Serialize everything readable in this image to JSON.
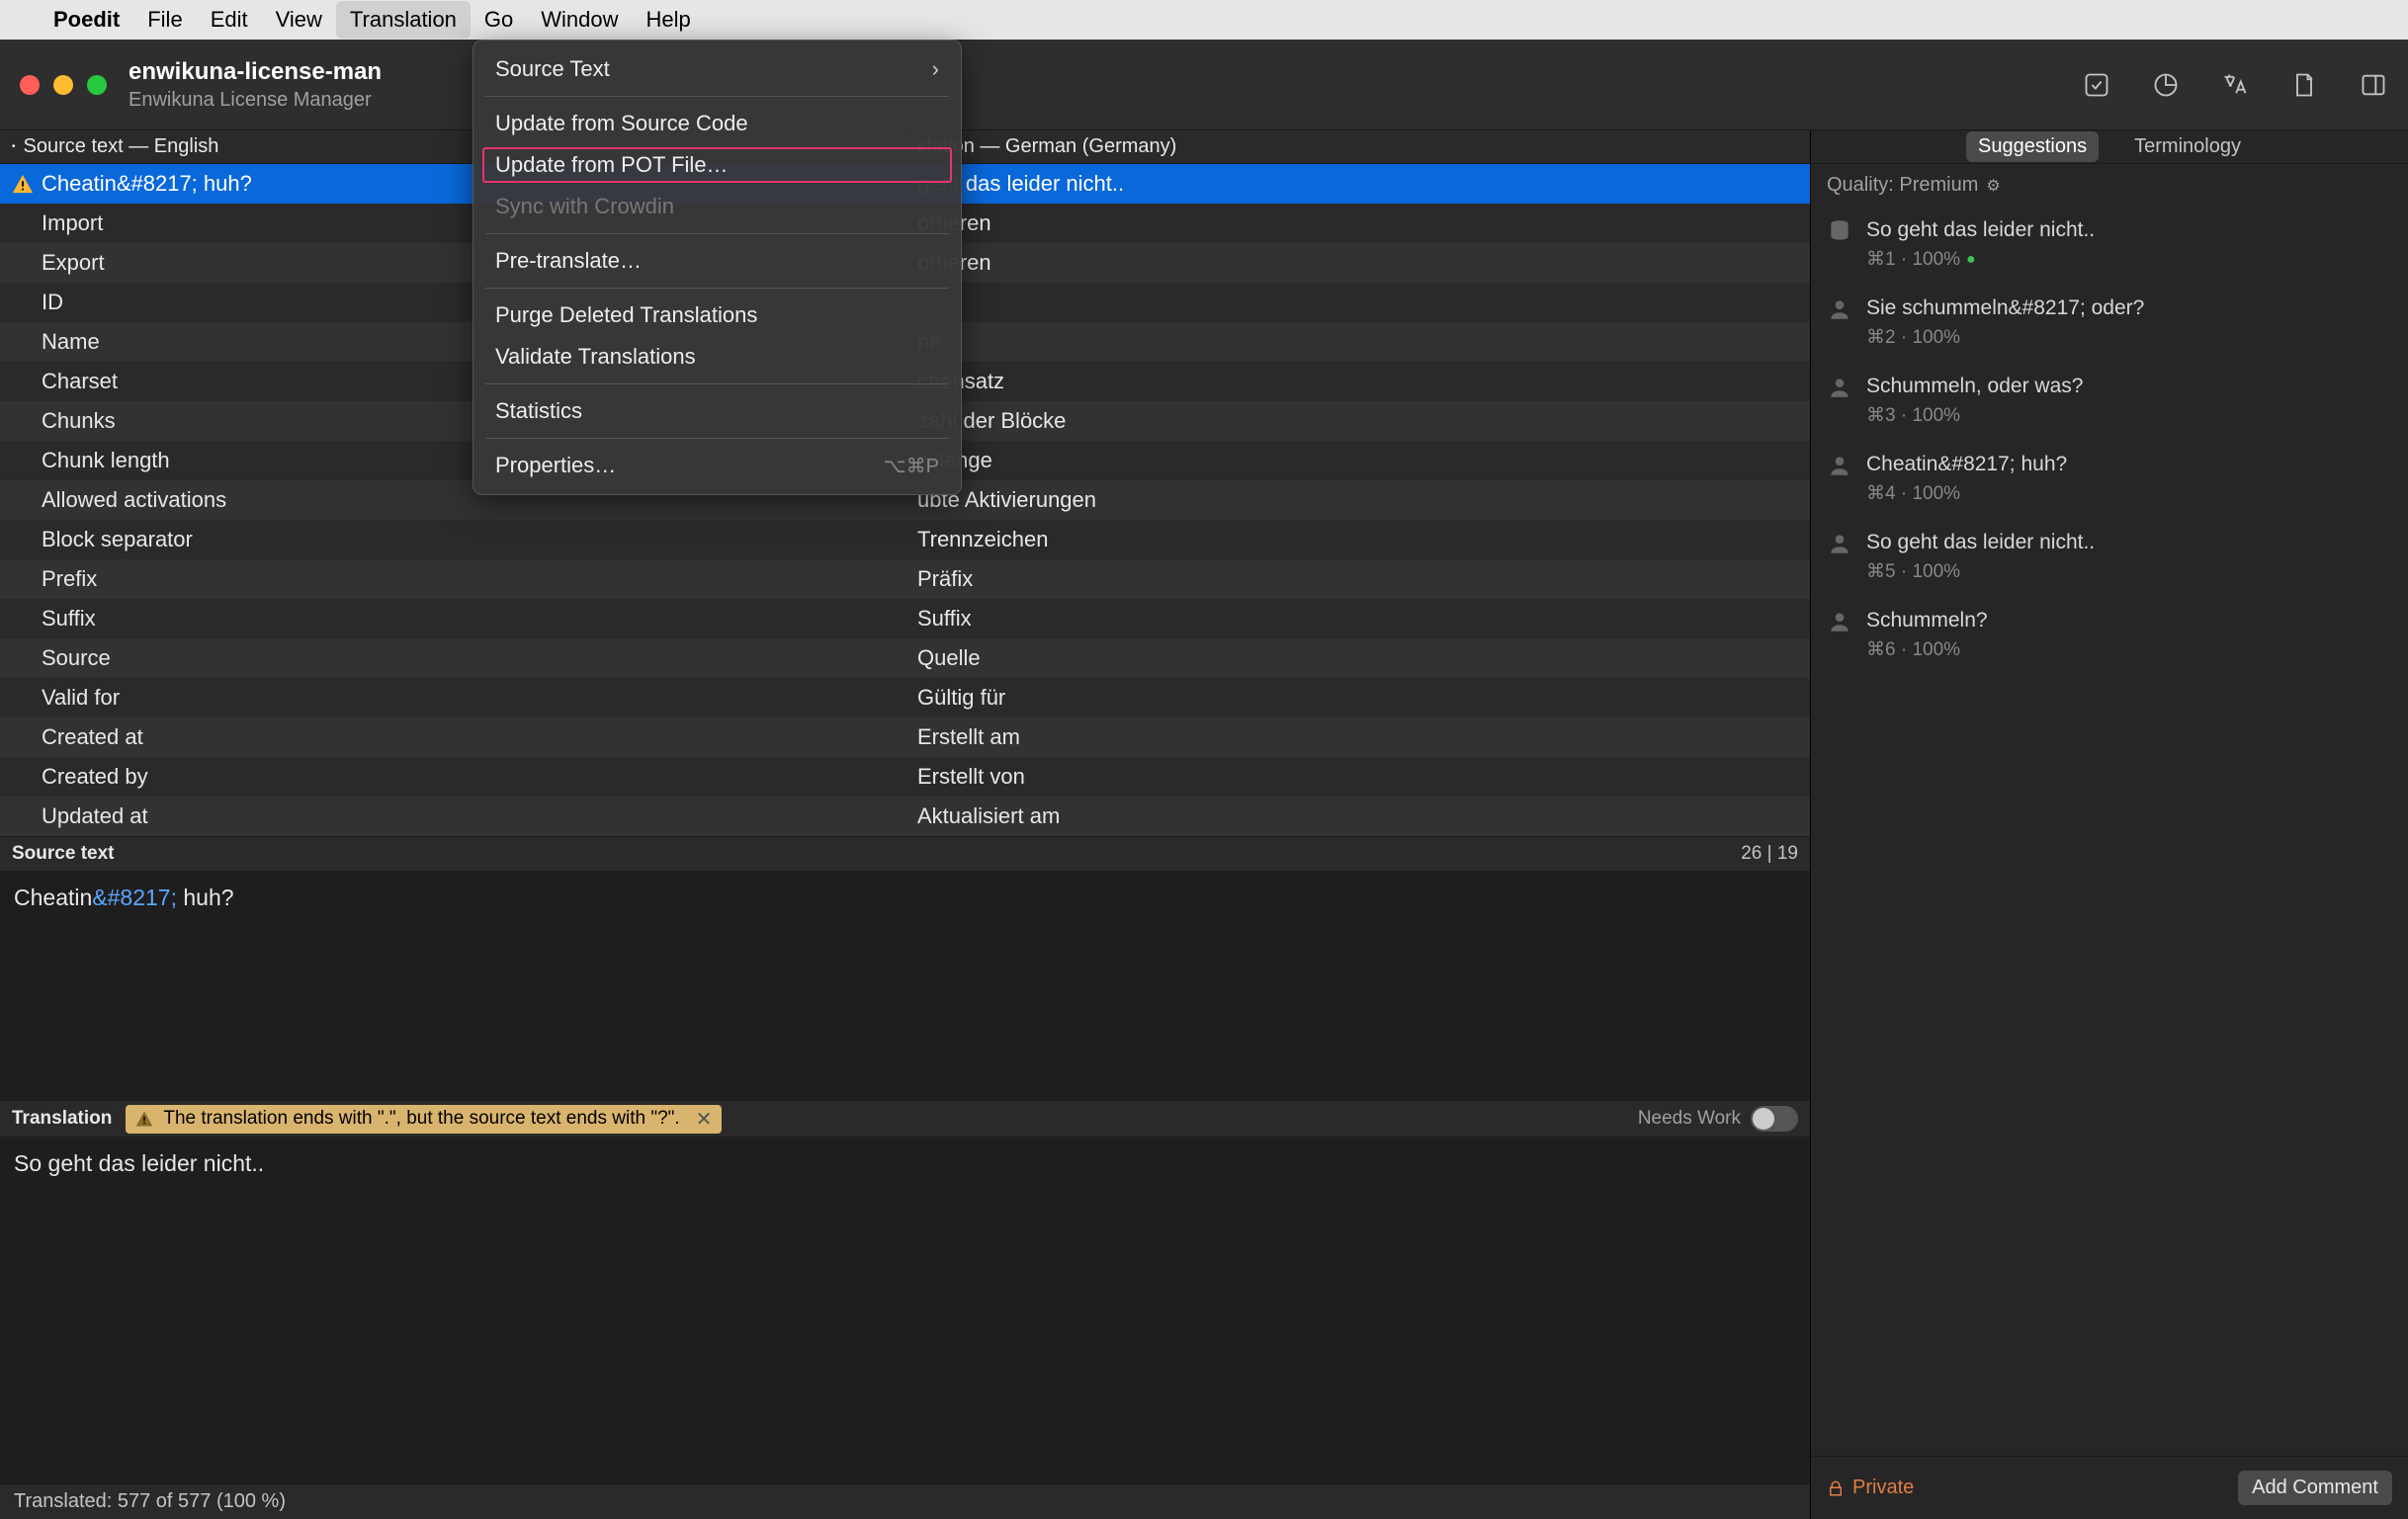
{
  "menubar": {
    "appname": "Poedit",
    "items": [
      "File",
      "Edit",
      "View",
      "Translation",
      "Go",
      "Window",
      "Help"
    ],
    "active_index": 3
  },
  "dropdown": {
    "items": [
      {
        "label": "Source Text",
        "submenu": true
      },
      {
        "sep": true
      },
      {
        "label": "Update from Source Code"
      },
      {
        "label": "Update from POT File…",
        "highlighted": true
      },
      {
        "label": "Sync with Crowdin",
        "disabled": true
      },
      {
        "sep": true
      },
      {
        "label": "Pre-translate…"
      },
      {
        "sep": true
      },
      {
        "label": "Purge Deleted Translations"
      },
      {
        "label": "Validate Translations"
      },
      {
        "sep": true
      },
      {
        "label": "Statistics"
      },
      {
        "sep": true
      },
      {
        "label": "Properties…",
        "shortcut": "⌥⌘P"
      }
    ]
  },
  "window": {
    "title": "enwikuna-license-man",
    "subtitle": "Enwikuna License Manager"
  },
  "columns": {
    "source": "Source text — English",
    "translation": "slation — German (Germany)"
  },
  "rows": [
    {
      "src": "Cheatin&#8217; huh?",
      "trg": "geht das leider nicht..",
      "warn": true,
      "selected": true
    },
    {
      "src": "Import",
      "trg": "ortieren"
    },
    {
      "src": "Export",
      "trg": "ortieren"
    },
    {
      "src": "ID",
      "trg": ""
    },
    {
      "src": "Name",
      "trg": "ne"
    },
    {
      "src": "Charset",
      "trg": "chensatz"
    },
    {
      "src": "Chunks",
      "trg": "zahl der Blöcke"
    },
    {
      "src": "Chunk length",
      "trg": "cklänge"
    },
    {
      "src": "Allowed activations",
      "trg": "ubte Aktivierungen"
    },
    {
      "src": "Block separator",
      "trg": "Trennzeichen"
    },
    {
      "src": "Prefix",
      "trg": "Präfix"
    },
    {
      "src": "Suffix",
      "trg": "Suffix"
    },
    {
      "src": "Source",
      "trg": "Quelle"
    },
    {
      "src": "Valid for",
      "trg": "Gültig für"
    },
    {
      "src": "Created at",
      "trg": "Erstellt am"
    },
    {
      "src": "Created by",
      "trg": "Erstellt von"
    },
    {
      "src": "Updated at",
      "trg": "Aktualisiert am"
    }
  ],
  "source_panel": {
    "label": "Source text",
    "counter": "26 | 19",
    "text_pre": "Cheatin",
    "text_entity": "&#8217;",
    "text_post": " huh?"
  },
  "translation_panel": {
    "label": "Translation",
    "warning": "The translation ends with \".\", but the source text ends with \"?\".",
    "needs_work": "Needs Work",
    "text": "So geht das leider nicht.."
  },
  "statusbar": "Translated: 577 of 577 (100 %)",
  "sidebar": {
    "tabs": [
      "Suggestions",
      "Terminology"
    ],
    "active_tab": 0,
    "quality": "Quality: Premium",
    "suggestions": [
      {
        "text": "So geht das leider nicht..",
        "meta": "⌘1 · 100%",
        "check": true,
        "icon": "db"
      },
      {
        "text": "Sie schummeln&#8217; oder?",
        "meta": "⌘2 · 100%",
        "icon": "person"
      },
      {
        "text": "Schummeln, oder was?",
        "meta": "⌘3 · 100%",
        "icon": "person"
      },
      {
        "text": "Cheatin&#8217; huh?",
        "meta": "⌘4 · 100%",
        "icon": "person"
      },
      {
        "text": "So geht das leider nicht..",
        "meta": "⌘5 · 100%",
        "icon": "person"
      },
      {
        "text": "Schummeln?",
        "meta": "⌘6 · 100%",
        "icon": "person"
      }
    ],
    "private": "Private",
    "add_comment": "Add Comment"
  }
}
